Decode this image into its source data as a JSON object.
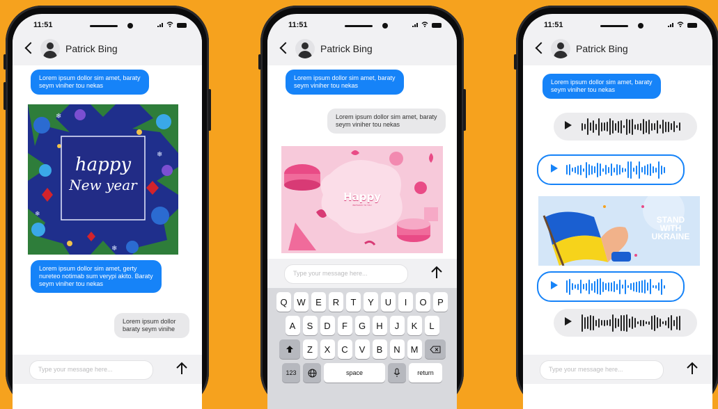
{
  "status": {
    "time": "11:51"
  },
  "contact": {
    "name": "Patrick Bing"
  },
  "input": {
    "placeholder": "Type your message here..."
  },
  "phones": [
    {
      "messages": [
        "Lorem ipsum dollor sim amet, baraty seym viniher tou nekas",
        "Lorem ipsum dollor sim amet, gerty nureteo notimab sum verypi akito. Baraty seym viniher tou nekas",
        "Lorem ipsum dollor baraty seym vinihe"
      ],
      "card": {
        "line1": "happy",
        "line2": "New year"
      },
      "input_placeholder": "Type your message here..."
    },
    {
      "messages": [
        "Lorem ipsum dollor sim amet, baraty seym viniher tou nekas",
        "Lorem ipsum dollor sim amet, baraty seym viniher tou nekas"
      ],
      "card": {
        "line1": "Happy",
        "line2": "BIRTHDAY TO YOU"
      },
      "input_placeholder": "Type your message here..."
    },
    {
      "messages": [
        "Lorem ipsum dollor sim amet, baraty seym viniher tou nekas"
      ],
      "card": {
        "line1": "STAND",
        "line2": "WITH",
        "line3": "UKRAINE"
      },
      "input_placeholder": "Type your message here..."
    }
  ],
  "keyboard": {
    "row1": [
      "Q",
      "W",
      "E",
      "R",
      "T",
      "Y",
      "U",
      "I",
      "O",
      "P"
    ],
    "row2": [
      "A",
      "S",
      "D",
      "F",
      "G",
      "H",
      "J",
      "K",
      "L"
    ],
    "row3": [
      "Z",
      "X",
      "C",
      "V",
      "B",
      "N",
      "M"
    ],
    "numbers_label": "123",
    "space_label": "space",
    "return_label": "return"
  },
  "colors": {
    "background": "#F6A21E",
    "accent": "#1683F8",
    "bubble_grey": "#E8E8EA"
  }
}
